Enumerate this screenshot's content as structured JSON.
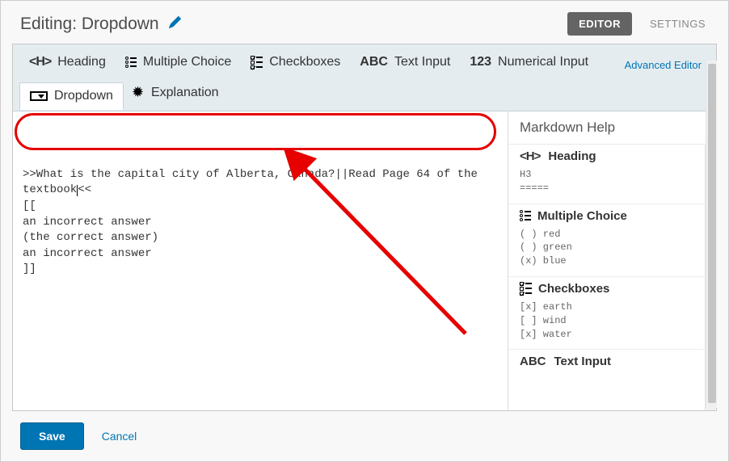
{
  "header": {
    "title": "Editing: Dropdown",
    "tabs": {
      "editor": "EDITOR",
      "settings": "SETTINGS"
    }
  },
  "toolbar": {
    "heading": "Heading",
    "multiple_choice": "Multiple Choice",
    "checkboxes": "Checkboxes",
    "text_input": "Text Input",
    "numerical_input": "Numerical Input",
    "dropdown": "Dropdown",
    "explanation": "Explanation",
    "advanced_editor": "Advanced Editor"
  },
  "editor": {
    "line1": ">>What is the capital city of Alberta, Canada?||Read Page 64 of the ",
    "line2_pre": "textbook",
    "line2_post": "<<",
    "rest": "\n[[\nan incorrect answer\n(the correct answer)\nan incorrect answer\n]]"
  },
  "help": {
    "title": "Markdown Help",
    "heading": {
      "label": "Heading",
      "example": "H3\n====="
    },
    "multiple_choice": {
      "label": "Multiple Choice",
      "example": "( ) red\n( ) green\n(x) blue"
    },
    "checkboxes": {
      "label": "Checkboxes",
      "example": "[x] earth\n[ ] wind\n[x] water"
    },
    "text_input": {
      "label": "Text Input"
    }
  },
  "footer": {
    "save": "Save",
    "cancel": "Cancel"
  }
}
